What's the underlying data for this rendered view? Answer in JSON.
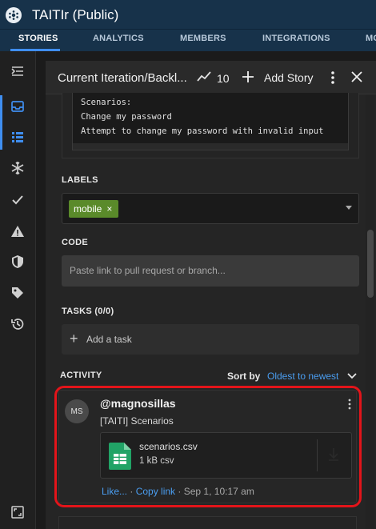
{
  "app": {
    "title": "TAITIr (Public)"
  },
  "nav": {
    "tabs": [
      {
        "label": "STORIES",
        "active": true
      },
      {
        "label": "ANALYTICS",
        "active": false
      },
      {
        "label": "MEMBERS",
        "active": false
      },
      {
        "label": "INTEGRATIONS",
        "active": false
      },
      {
        "label": "MO",
        "active": false
      }
    ]
  },
  "sidebar": {
    "icons": [
      "collapse-menu-icon",
      "inbox-icon",
      "list-icon",
      "snowflake-icon",
      "check-icon",
      "warning-icon",
      "shield-icon",
      "tag-icon",
      "history-icon",
      "fullscreen-icon"
    ]
  },
  "panel": {
    "title": "Current Iteration/Backl...",
    "points": "10",
    "add_story_label": "Add Story"
  },
  "description": {
    "lines": [
      "Scenarios:",
      "Change my password",
      "Attempt to change my password with invalid input"
    ]
  },
  "labels": {
    "heading": "LABELS",
    "chips": [
      "mobile"
    ],
    "chip_remove": "×"
  },
  "code": {
    "heading": "CODE",
    "placeholder": "Paste link to pull request or branch..."
  },
  "tasks": {
    "heading": "TASKS (0/0)",
    "add_label": "Add a task",
    "plus": "+"
  },
  "activity": {
    "heading": "ACTIVITY",
    "sort_by_label": "Sort by",
    "sort_value": "Oldest to newest",
    "comment": {
      "avatar_initials": "MS",
      "author": "@magnosillas",
      "text": "[TAITI] Scenarios",
      "attachment": {
        "name": "scenarios.csv",
        "meta": "1 kB csv"
      },
      "like_label": "Like...",
      "separator": "·",
      "copy_link_label": "Copy link",
      "timestamp": "Sep 1, 10:17 am"
    }
  },
  "colors": {
    "topbar": "#17324a",
    "accent": "#3f8ef0",
    "link": "#4a9df0",
    "label_chip": "#5a8a2a",
    "highlight": "#e3141a",
    "sheet_icon": "#21a366"
  }
}
